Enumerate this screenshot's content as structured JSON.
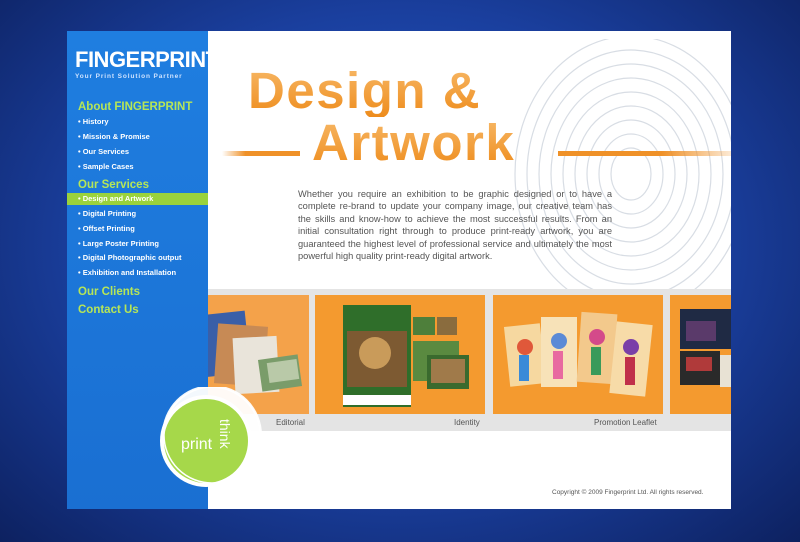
{
  "brand": {
    "name": "FINGERPRINT",
    "tagline": "Your Print Solution Partner"
  },
  "nav": {
    "about_heading": "About FINGERPRINT",
    "about_items": [
      "• History",
      "• Mission & Promise",
      "• Our Services",
      "• Sample Cases"
    ],
    "services_heading": "Our Services",
    "services_items": [
      "• Design and Artwork",
      "• Digital Printing",
      "• Offset Printing",
      "• Large Poster Printing",
      "• Digital Photographic output",
      "• Exhibition and Installation"
    ],
    "active_item": "Design and Artwork",
    "clients": "Our Clients",
    "contact": "Contact Us"
  },
  "page": {
    "title_line1": "Design &",
    "title_line2": "Artwork",
    "intro": "Whether you require an exhibition to be graphic designed or to have a complete re-brand to update your company image, our creative team has the skills and know-how to achieve the most successful results. From an initial consultation right through to produce print-ready artwork, you are guaranteed the highest level of professional service and ultimately the most powerful high quality print-ready digital artwork."
  },
  "gallery": {
    "captions": [
      "Editorial",
      "Identity",
      "Promotion Leaflet"
    ]
  },
  "badge": {
    "word1": "print",
    "word2": "think"
  },
  "footer": {
    "copyright": "Copyright © 2009 Fingerprint Ltd. All rights reserved."
  },
  "colors": {
    "accent_orange": "#f29a2e",
    "accent_green": "#9ad23c",
    "nav_blue": "#1f7ee0",
    "bg_blue": "#1a3f9e"
  }
}
